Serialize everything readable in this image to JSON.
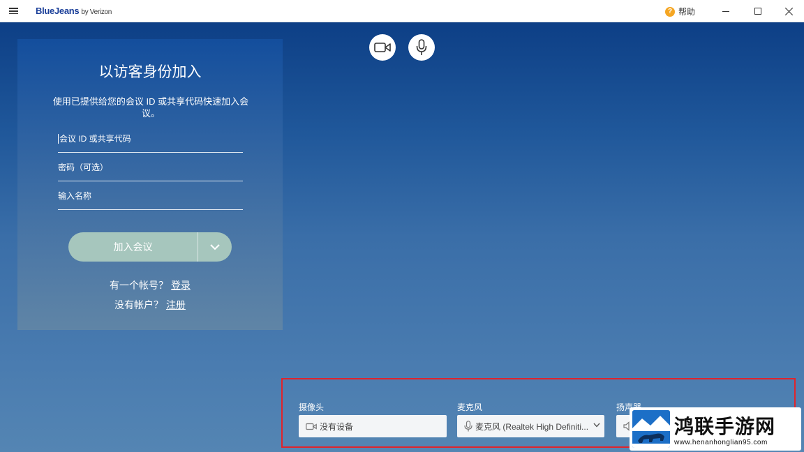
{
  "titlebar": {
    "brand": "BlueJeans",
    "brand_suffix": "by Verizon",
    "help_label": "帮助",
    "help_icon_glyph": "?"
  },
  "panel": {
    "title": "以访客身份加入",
    "description": "使用已提供给您的会议 ID 或共享代码快速加入会议。",
    "fields": {
      "meeting_id_placeholder": "会议 ID 或共享代码",
      "password_placeholder": "密码（可选）",
      "name_placeholder": "输入名称"
    },
    "join_button_label": "加入会议",
    "account_prompt": "有一个帐号？",
    "login_link": "登录",
    "no_account_prompt": "没有帐户？",
    "register_link": "注册"
  },
  "devices": {
    "camera_label": "摄像头",
    "camera_value": "没有设备",
    "microphone_label": "麦克风",
    "microphone_value": "麦克风 (Realtek High Definiti...",
    "speaker_label": "扬声器"
  },
  "watermark": {
    "text": "鸿联手游网",
    "url": "www.henanhonglian95.com"
  },
  "colors": {
    "join_button": "#a6c6bd",
    "highlight_border": "#e0242b",
    "help_icon": "#f5a623"
  }
}
